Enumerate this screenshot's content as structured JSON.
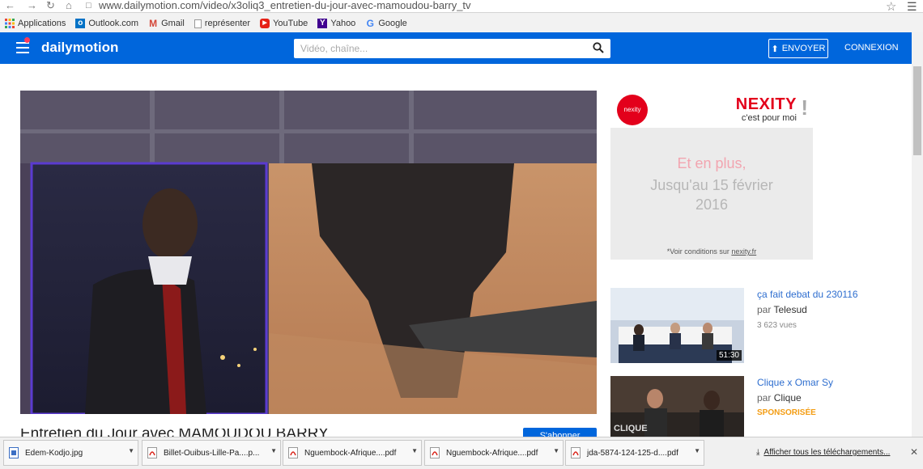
{
  "browser": {
    "url": "www.dailymotion.com/video/x3oliq3_entretien-du-jour-avec-mamoudou-barry_tv",
    "bookmarks": [
      {
        "label": "Applications",
        "icon": "apps-icon"
      },
      {
        "label": "Outlook.com",
        "icon": "outlook-icon"
      },
      {
        "label": "Gmail",
        "icon": "gmail-icon"
      },
      {
        "label": "représenter",
        "icon": "page-icon"
      },
      {
        "label": "YouTube",
        "icon": "youtube-icon"
      },
      {
        "label": "Yahoo",
        "icon": "yahoo-icon"
      },
      {
        "label": "Google",
        "icon": "google-icon"
      }
    ]
  },
  "header": {
    "logo": "dailymotion",
    "search_placeholder": "Vidéo, chaîne...",
    "upload_label": "ENVOYER",
    "login_label": "CONNEXION",
    "brand_color": "#0066dc"
  },
  "video": {
    "title": "Entretien du Jour avec MAMOUDOU BARRY",
    "follow_label": "S'abonner"
  },
  "ad": {
    "logo_text": "nexity",
    "brand": "NEXITY",
    "tagline": "c'est pour moi",
    "line1": "Et en plus,",
    "line2": "Jusqu'au 15 février",
    "line3": "2016",
    "conditions_prefix": "*Voir conditions sur ",
    "conditions_link": "nexity.fr"
  },
  "related": [
    {
      "title": "ça fait debat du 230116",
      "by_prefix": "par",
      "channel": "Telesud",
      "views": "3 623 vues",
      "duration": "51:30"
    },
    {
      "title": "Clique x Omar Sy",
      "by_prefix": "par",
      "channel": "Clique",
      "sponsored": "SPONSORISÉE"
    }
  ],
  "downloads": {
    "items": [
      {
        "name": "Edem-Kodjo.jpg",
        "type": "image"
      },
      {
        "name": "Billet-Ouibus-Lille-Pa....p...",
        "type": "pdf"
      },
      {
        "name": "Nguembock-Afrique....pdf",
        "type": "pdf"
      },
      {
        "name": "Nguembock-Afrique....pdf",
        "type": "pdf"
      },
      {
        "name": "jda-5874-124-125-d....pdf",
        "type": "pdf"
      }
    ],
    "show_all": "Afficher tous les téléchargements..."
  }
}
